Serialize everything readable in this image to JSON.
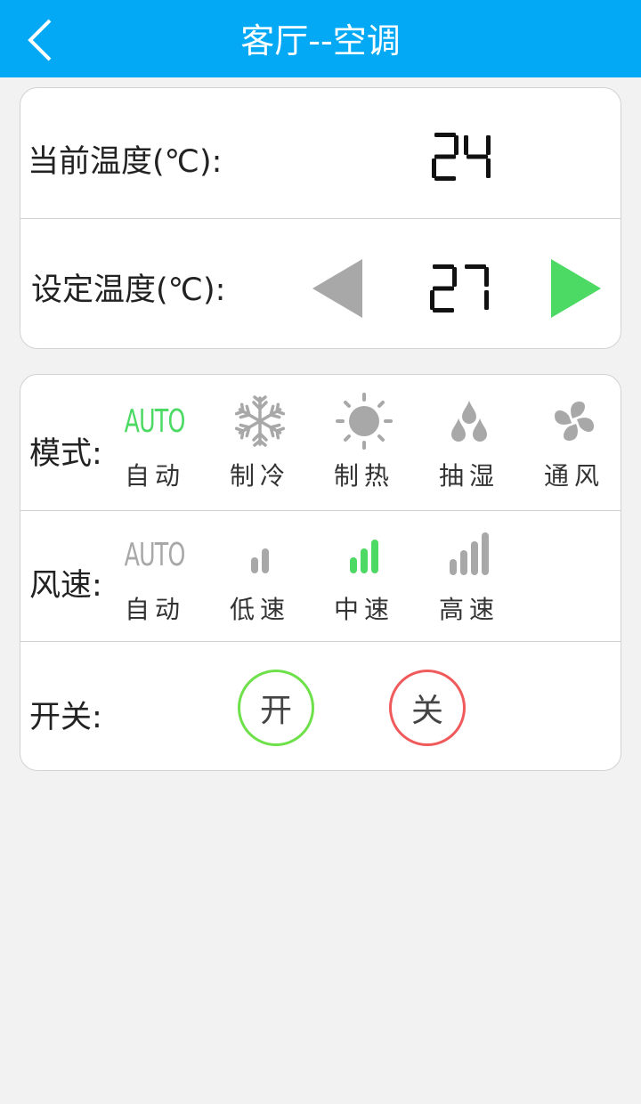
{
  "header": {
    "title": "客厅--空调"
  },
  "temperature": {
    "current_label": "当前温度(℃):",
    "current_value": 24,
    "set_label": "设定温度(℃):",
    "set_value": 27
  },
  "mode": {
    "label": "模式:",
    "options": [
      {
        "label": "自动",
        "icon": "auto-icon",
        "selected": true
      },
      {
        "label": "制冷",
        "icon": "snowflake-icon",
        "selected": false
      },
      {
        "label": "制热",
        "icon": "sun-icon",
        "selected": false
      },
      {
        "label": "抽湿",
        "icon": "drops-icon",
        "selected": false
      },
      {
        "label": "通风",
        "icon": "fan-icon",
        "selected": false
      }
    ]
  },
  "fan_speed": {
    "label": "风速:",
    "options": [
      {
        "label": "自动",
        "icon": "auto-icon",
        "selected": false
      },
      {
        "label": "低速",
        "icon": "signal-low-icon",
        "selected": false
      },
      {
        "label": "中速",
        "icon": "signal-medium-icon",
        "selected": true
      },
      {
        "label": "高速",
        "icon": "signal-high-icon",
        "selected": false
      }
    ]
  },
  "power": {
    "label": "开关:",
    "on_label": "开",
    "off_label": "关"
  },
  "auto_text": "AUTO",
  "colors": {
    "header_bg": "#03a9f4",
    "accent_green": "#4cd964",
    "inactive_gray": "#a8a8a8",
    "off_red": "#f05a5a"
  }
}
